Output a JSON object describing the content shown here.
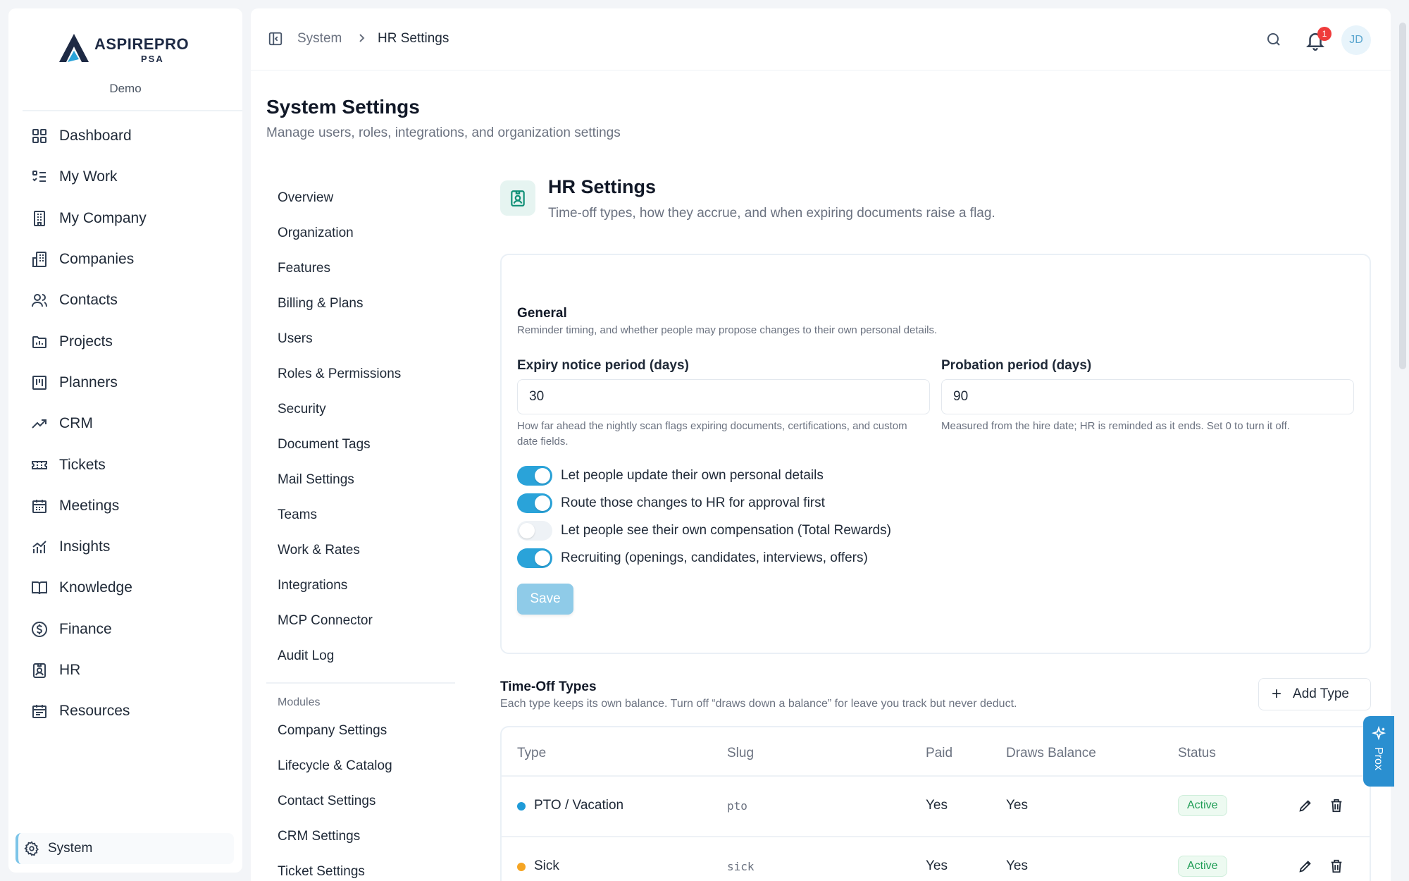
{
  "brand": {
    "name": "ASPIREPRO",
    "sub": "PSA",
    "workspace": "Demo"
  },
  "sidebar": {
    "items": [
      {
        "label": "Dashboard",
        "icon": "grid-icon"
      },
      {
        "label": "My Work",
        "icon": "list-check-icon"
      },
      {
        "label": "My Company",
        "icon": "building-icon"
      },
      {
        "label": "Companies",
        "icon": "buildings-icon"
      },
      {
        "label": "Contacts",
        "icon": "users-icon"
      },
      {
        "label": "Projects",
        "icon": "folder-chart-icon"
      },
      {
        "label": "Planners",
        "icon": "kanban-icon"
      },
      {
        "label": "CRM",
        "icon": "trend-up-icon"
      },
      {
        "label": "Tickets",
        "icon": "ticket-icon"
      },
      {
        "label": "Meetings",
        "icon": "calendar-icon"
      },
      {
        "label": "Insights",
        "icon": "bar-chart-icon"
      },
      {
        "label": "Knowledge",
        "icon": "book-icon"
      },
      {
        "label": "Finance",
        "icon": "dollar-circle-icon"
      },
      {
        "label": "HR",
        "icon": "id-badge-icon"
      },
      {
        "label": "Resources",
        "icon": "calendar-grid-icon"
      }
    ],
    "system": {
      "label": "System",
      "icon": "gear-icon"
    }
  },
  "topbar": {
    "breadcrumb": [
      "System",
      "HR Settings"
    ],
    "notification_count": "1",
    "avatar_initials": "JD"
  },
  "page": {
    "title": "System Settings",
    "subtitle": "Manage users, roles, integrations, and organization settings"
  },
  "settings_nav": {
    "items": [
      "Overview",
      "Organization",
      "Features",
      "Billing & Plans",
      "Users",
      "Roles & Permissions",
      "Security",
      "Document Tags",
      "Mail Settings",
      "Teams",
      "Work & Rates",
      "Integrations",
      "MCP Connector",
      "Audit Log"
    ],
    "modules_heading": "Modules",
    "modules": [
      "Company Settings",
      "Lifecycle & Catalog",
      "Contact Settings",
      "CRM Settings",
      "Ticket Settings"
    ]
  },
  "hr": {
    "title": "HR Settings",
    "subtitle": "Time-off types, how they accrue, and when expiring documents raise a flag.",
    "general": {
      "title": "General",
      "subtitle": "Reminder timing, and whether people may propose changes to their own personal details.",
      "expiry": {
        "label": "Expiry notice period (days)",
        "value": "30",
        "help": "How far ahead the nightly scan flags expiring documents, certifications, and custom date fields."
      },
      "probation": {
        "label": "Probation period (days)",
        "value": "90",
        "help": "Measured from the hire date; HR is reminded as it ends. Set 0 to turn it off."
      },
      "toggles": [
        {
          "label": "Let people update their own personal details",
          "on": true
        },
        {
          "label": "Route those changes to HR for approval first",
          "on": true
        },
        {
          "label": "Let people see their own compensation (Total Rewards)",
          "on": false
        },
        {
          "label": "Recruiting (openings, candidates, interviews, offers)",
          "on": true
        }
      ],
      "save_label": "Save"
    },
    "time_off": {
      "title": "Time-Off Types",
      "subtitle": "Each type keeps its own balance. Turn off “draws down a balance” for leave you track but never deduct.",
      "add_label": "Add Type",
      "columns": [
        "Type",
        "Slug",
        "Paid",
        "Draws Balance",
        "Status"
      ],
      "rows": [
        {
          "type": "PTO / Vacation",
          "slug": "pto",
          "paid": "Yes",
          "draws": "Yes",
          "status": "Active",
          "color": "#1f9bd8"
        },
        {
          "type": "Sick",
          "slug": "sick",
          "paid": "Yes",
          "draws": "Yes",
          "status": "Active",
          "color": "#f5a524"
        }
      ]
    }
  },
  "prox": {
    "label": "Prox",
    "icon": "sparkle-icon"
  }
}
